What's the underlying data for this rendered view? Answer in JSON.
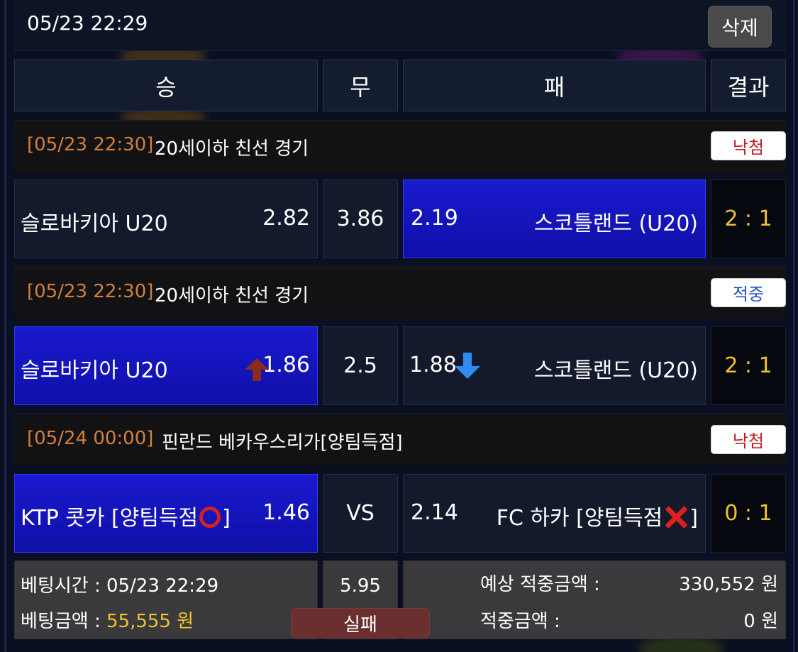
{
  "colors": {
    "selected_bg": "#1a1acf",
    "lose_badge_text": "#c02020",
    "win_badge_text": "#2050c0",
    "match_time": "#d4803a",
    "score": "#f2c230",
    "down_arrow": "#2f8cf3",
    "up_arrow": "#8b2b1c"
  },
  "header": {
    "datetime": "05/23 22:29",
    "delete_label": "삭제"
  },
  "columns": {
    "win": "승",
    "draw": "무",
    "lose": "패",
    "result": "결과"
  },
  "matches": [
    {
      "time": "[05/23 22:30]",
      "league": "20세이하 친선 경기",
      "status": "낙첨",
      "home": "슬로바키아 U20",
      "home_odds": "2.82",
      "draw": "3.86",
      "away_odds": "2.19",
      "away": "스코틀랜드 (U20)",
      "score": "2 : 1",
      "selected": "away"
    },
    {
      "time": "[05/23 22:30]",
      "league": "20세이하 친선 경기",
      "status": "적중",
      "home": "슬로바키아 U20",
      "home_odds": "1.86",
      "home_odds_trend": "up",
      "draw": "2.5",
      "away_odds": "1.88",
      "away_odds_trend": "down",
      "away": "스코틀랜드 (U20)",
      "score": "2 : 1",
      "selected": "home"
    },
    {
      "time": "[05/24 00:00]",
      "league": "핀란드 베카우스리가[양팀득점]",
      "status": "낙첨",
      "home": "KTP 콧카 [양팀득점",
      "home_suffix": "]",
      "home_mark": "circle",
      "home_odds": "1.46",
      "draw": "VS",
      "away_odds": "2.14",
      "away": "FC 하카 [양팀득점",
      "away_suffix": "]",
      "away_mark": "cross",
      "score": "0 : 1",
      "selected": "home"
    }
  ],
  "footer": {
    "bet_time_label": "베팅시간 : ",
    "bet_time": "05/23 22:29",
    "bet_amount_label": "베팅금액 : ",
    "bet_amount": "55,555 원",
    "total_odds": "5.95",
    "result_label": "실패",
    "expected_win_label": "예상 적중금액 :",
    "expected_win": "330,552 원",
    "win_amount_label": "적중금액 :",
    "win_amount": "0 원"
  }
}
